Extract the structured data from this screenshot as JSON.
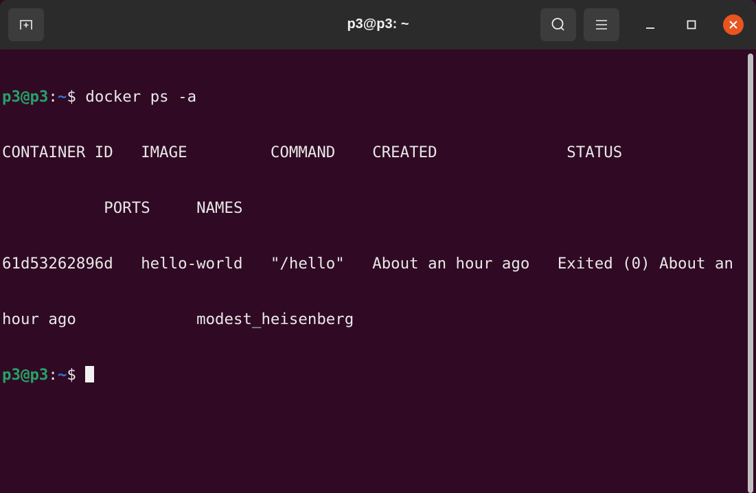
{
  "window": {
    "title": "p3@p3: ~"
  },
  "titlebar": {
    "new_tab_icon": "new-tab-icon",
    "search_icon": "search-icon",
    "menu_icon": "hamburger-menu-icon",
    "close_color": "#e95420"
  },
  "terminal": {
    "background": "#300a24",
    "prompt": {
      "user": "p3@p3",
      "sep": ":",
      "path": "~",
      "symbol": "$ "
    },
    "command": "docker ps -a",
    "output_lines": [
      "CONTAINER ID   IMAGE         COMMAND    CREATED              STATUS",
      "           PORTS     NAMES",
      "61d53262896d   hello-world   \"/hello\"   About an hour ago   Exited (0) About an",
      "hour ago             modest_heisenberg"
    ]
  }
}
